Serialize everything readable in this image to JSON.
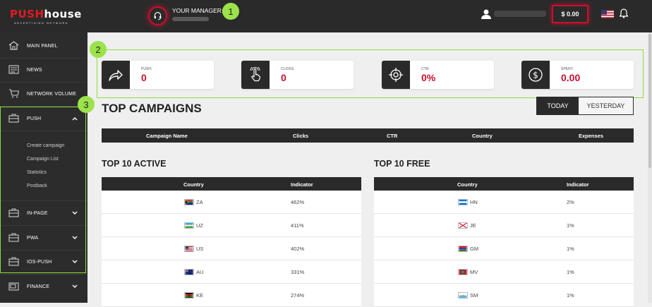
{
  "brand": {
    "logo_part1": "PUSH",
    "logo_part2": "house",
    "tagline": "ADVERTISING NETWORK"
  },
  "header": {
    "manager_label": "YOUR MANAGER:",
    "balance": "$ 0.00",
    "colors": {
      "accent": "#c8102e",
      "topbar": "#2a2a2a",
      "callout": "#9be34a"
    }
  },
  "callouts": {
    "c1": "1",
    "c2": "2",
    "c3": "3"
  },
  "sidebar": {
    "main_panel": "MAIN PANEL",
    "news": "NEWS",
    "network_volume": "NETWORK VOLUME",
    "push": "PUSH",
    "push_sub": [
      "Create campaign",
      "Campaign List",
      "Statistics",
      "Postback"
    ],
    "in_page": "IN-PAGE",
    "pwa": "PWA",
    "ios_push": "IOS-PUSH",
    "finance": "FINANCE"
  },
  "stats": [
    {
      "name": "PUSH:",
      "value": "0",
      "icon": "share-arrow-icon"
    },
    {
      "name": "CLICKS:",
      "value": "0",
      "icon": "tap-hand-icon"
    },
    {
      "name": "CTR:",
      "value": "0%",
      "icon": "crosshair-icon"
    },
    {
      "name": "SPENT:",
      "value": "0.00",
      "icon": "dollar-circle-icon"
    }
  ],
  "top_campaigns": {
    "title": "TOP CAMPAIGNS",
    "today": "TODAY",
    "yesterday": "YESTERDAY",
    "columns": [
      "Campaign Name",
      "Clicks",
      "CTR",
      "Country",
      "Expenses"
    ]
  },
  "top_active": {
    "title": "TOP 10 ACTIVE",
    "columns": [
      "Country",
      "Indicator"
    ],
    "rows": [
      {
        "country": "ZA",
        "indicator": "462%"
      },
      {
        "country": "UZ",
        "indicator": "411%"
      },
      {
        "country": "US",
        "indicator": "402%"
      },
      {
        "country": "AU",
        "indicator": "331%"
      },
      {
        "country": "KE",
        "indicator": "274%"
      }
    ]
  },
  "top_free": {
    "title": "TOP 10 FREE",
    "columns": [
      "Country",
      "Indicator"
    ],
    "rows": [
      {
        "country": "HN",
        "indicator": "2%"
      },
      {
        "country": "JE",
        "indicator": "1%"
      },
      {
        "country": "GM",
        "indicator": "1%"
      },
      {
        "country": "MV",
        "indicator": "1%"
      },
      {
        "country": "SM",
        "indicator": "1%"
      }
    ]
  }
}
